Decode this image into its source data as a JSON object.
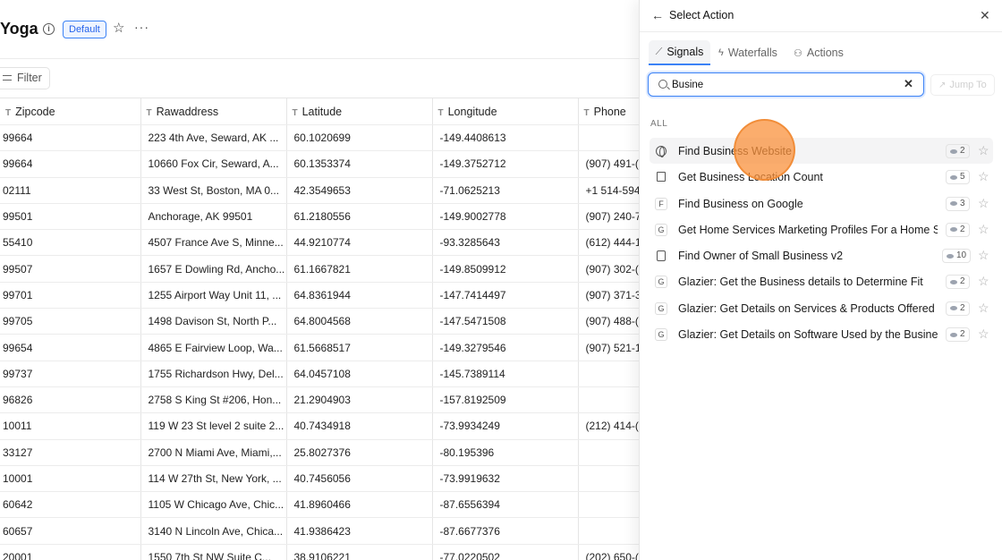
{
  "workspace": {
    "title": "Yoga",
    "badge": "Default",
    "filter_label": "Filter",
    "columns": [
      "Zipcode",
      "Rawaddress",
      "Latitude",
      "Longitude",
      "Phone"
    ],
    "rows": [
      [
        "99664",
        "223 4th Ave, Seward, AK ...",
        "60.1020699",
        "-149.4408613",
        ""
      ],
      [
        "99664",
        "10660 Fox Cir, Seward, A...",
        "60.1353374",
        "-149.3752712",
        "(907) 491-("
      ],
      [
        "02111",
        "33 West St, Boston, MA 0...",
        "42.3549653",
        "-71.0625213",
        "+1 514-594"
      ],
      [
        "99501",
        "Anchorage, AK 99501",
        "61.2180556",
        "-149.9002778",
        "(907) 240-7"
      ],
      [
        "55410",
        "4507 France Ave S, Minne...",
        "44.9210774",
        "-93.3285643",
        "(612) 444-1"
      ],
      [
        "99507",
        "1657 E Dowling Rd, Ancho...",
        "61.1667821",
        "-149.8509912",
        "(907) 302-("
      ],
      [
        "99701",
        "1255 Airport Way Unit 11, ...",
        "64.8361944",
        "-147.7414497",
        "(907) 371-3"
      ],
      [
        "99705",
        "1498 Davison St, North P...",
        "64.8004568",
        "-147.5471508",
        "(907) 488-("
      ],
      [
        "99654",
        "4865 E Fairview Loop, Wa...",
        "61.5668517",
        "-149.3279546",
        "(907) 521-1"
      ],
      [
        "99737",
        "1755 Richardson Hwy, Del...",
        "64.0457108",
        "-145.7389114",
        ""
      ],
      [
        "96826",
        "2758 S King St #206, Hon...",
        "21.2904903",
        "-157.8192509",
        ""
      ],
      [
        "10011",
        "119 W 23 St level 2 suite 2...",
        "40.7434918",
        "-73.9934249",
        "(212) 414-("
      ],
      [
        "33127",
        "2700 N Miami Ave, Miami,...",
        "25.8027376",
        "-80.195396",
        ""
      ],
      [
        "10001",
        "114 W 27th St, New York, ...",
        "40.7456056",
        "-73.9919632",
        ""
      ],
      [
        "60642",
        "1105 W Chicago Ave, Chic...",
        "41.8960466",
        "-87.6556394",
        ""
      ],
      [
        "60657",
        "3140 N Lincoln Ave, Chica...",
        "41.9386423",
        "-87.6677376",
        ""
      ],
      [
        "20001",
        "1550 7th St NW Suite C...",
        "38.9106221",
        "-77.0220502",
        "(202) 650-("
      ]
    ]
  },
  "panel": {
    "title": "Select Action",
    "tabs": [
      {
        "label": "Signals",
        "icon": "signals-icon"
      },
      {
        "label": "Waterfalls",
        "icon": "bolt-icon"
      },
      {
        "label": "Actions",
        "icon": "actions-icon"
      }
    ],
    "search_value": "Busine",
    "jump_label": "Jump To",
    "section_label": "ALL",
    "items": [
      {
        "label": "Find Business Website",
        "credits": "2",
        "icon": "globe-icon",
        "letter": ""
      },
      {
        "label": "Get Business Location Count",
        "credits": "5",
        "icon": "building-icon",
        "letter": ""
      },
      {
        "label": "Find Business on Google",
        "credits": "3",
        "icon": "letter-icon",
        "letter": "F"
      },
      {
        "label": "Get Home Services Marketing Profiles For a Home Se...",
        "credits": "2",
        "icon": "letter-icon",
        "letter": "G"
      },
      {
        "label": "Find Owner of Small Business v2",
        "credits": "10",
        "icon": "document-icon",
        "letter": ""
      },
      {
        "label": "Glazier: Get the Business details to Determine Fit",
        "credits": "2",
        "icon": "letter-icon",
        "letter": "G"
      },
      {
        "label": "Glazier: Get Details on Services & Products Offered B...",
        "credits": "2",
        "icon": "letter-icon",
        "letter": "G"
      },
      {
        "label": "Glazier: Get Details on Software Used by the Business",
        "credits": "2",
        "icon": "letter-icon",
        "letter": "G"
      }
    ]
  }
}
